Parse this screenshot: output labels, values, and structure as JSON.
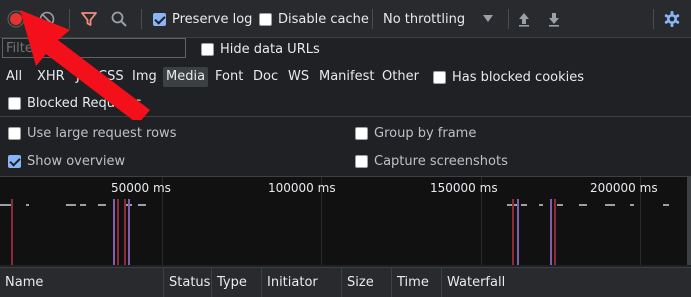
{
  "colors": {
    "record": "#e3342f",
    "accent": "#8ab4f8",
    "arrow": "#f4101a",
    "filter_icon": "#f28b82"
  },
  "toolbar": {
    "record_icon": "record-icon",
    "clear_icon": "clear-icon",
    "filter_icon": "filter-funnel-icon",
    "search_icon": "search-icon",
    "preserve_log": {
      "label": "Preserve log",
      "checked": true
    },
    "disable_cache": {
      "label": "Disable cache",
      "checked": false
    },
    "throttling": {
      "value": "No throttling"
    },
    "import_icon": "upload-arrow-icon",
    "export_icon": "download-arrow-icon",
    "settings_icon": "gear-icon"
  },
  "filter_bar": {
    "placeholder": "Filter",
    "hide_data_urls": {
      "label": "Hide data URLs",
      "checked": false
    },
    "types": [
      "All",
      "XHR",
      "JS",
      "CSS",
      "Img",
      "Media",
      "Font",
      "Doc",
      "WS",
      "Manifest",
      "Other"
    ],
    "active_type": "Media",
    "has_blocked_cookies": {
      "label": "Has blocked cookies",
      "checked": false
    },
    "blocked_requests": {
      "label": "Blocked Requests",
      "checked": false
    }
  },
  "settings": {
    "large_rows": {
      "label": "Use large request rows",
      "checked": false
    },
    "group_by_frame": {
      "label": "Group by frame",
      "checked": false
    },
    "show_overview": {
      "label": "Show overview",
      "checked": true
    },
    "capture_screenshots": {
      "label": "Capture screenshots",
      "checked": false
    }
  },
  "overview": {
    "ticks": [
      "50000 ms",
      "100000 ms",
      "150000 ms",
      "200000 ms"
    ]
  },
  "table": {
    "columns": [
      "Name",
      "Status",
      "Type",
      "Initiator",
      "Size",
      "Time",
      "Waterfall"
    ]
  }
}
